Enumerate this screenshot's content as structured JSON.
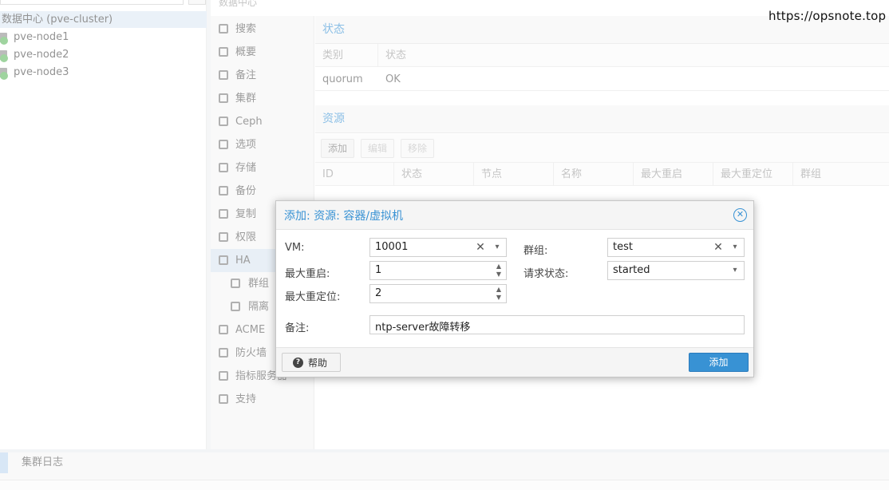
{
  "tree": {
    "root_label": "数据中心 (pve-cluster)",
    "nodes": [
      "pve-node1",
      "pve-node2",
      "pve-node3"
    ]
  },
  "breadcrumb": "数据中心",
  "menu": {
    "items": [
      "搜索",
      "概要",
      "备注",
      "集群",
      "Ceph",
      "选项",
      "存储",
      "备份",
      "复制",
      "权限",
      "HA",
      "群组",
      "隔离",
      "ACME",
      "防火墙",
      "指标服务器",
      "支持"
    ],
    "active": "HA"
  },
  "status_panel": {
    "title": "状态",
    "columns": [
      "类别",
      "状态"
    ],
    "rows": [
      [
        "quorum",
        "OK"
      ]
    ]
  },
  "resources_panel": {
    "title": "资源",
    "toolbar": {
      "add": "添加",
      "edit": "编辑",
      "remove": "移除"
    },
    "columns": [
      "ID",
      "状态",
      "节点",
      "名称",
      "最大重启",
      "最大重定位",
      "群组"
    ]
  },
  "bottom": {
    "tab": "集群日志"
  },
  "watermark": "https://opsnote.top",
  "dialog": {
    "title": "添加: 资源: 容器/虚拟机",
    "fields": {
      "vm_label": "VM:",
      "vm_value": "10001",
      "group_label": "群组:",
      "group_value": "test",
      "max_restart_label": "最大重启:",
      "max_restart_value": "1",
      "request_state_label": "请求状态:",
      "request_state_value": "started",
      "max_relocate_label": "最大重定位:",
      "max_relocate_value": "2",
      "comment_label": "备注:",
      "comment_value": "ntp-server故障转移"
    },
    "help_label": "帮助",
    "submit_label": "添加"
  },
  "colors": {
    "accent": "#3892d4",
    "ok": "#5bb55b"
  }
}
